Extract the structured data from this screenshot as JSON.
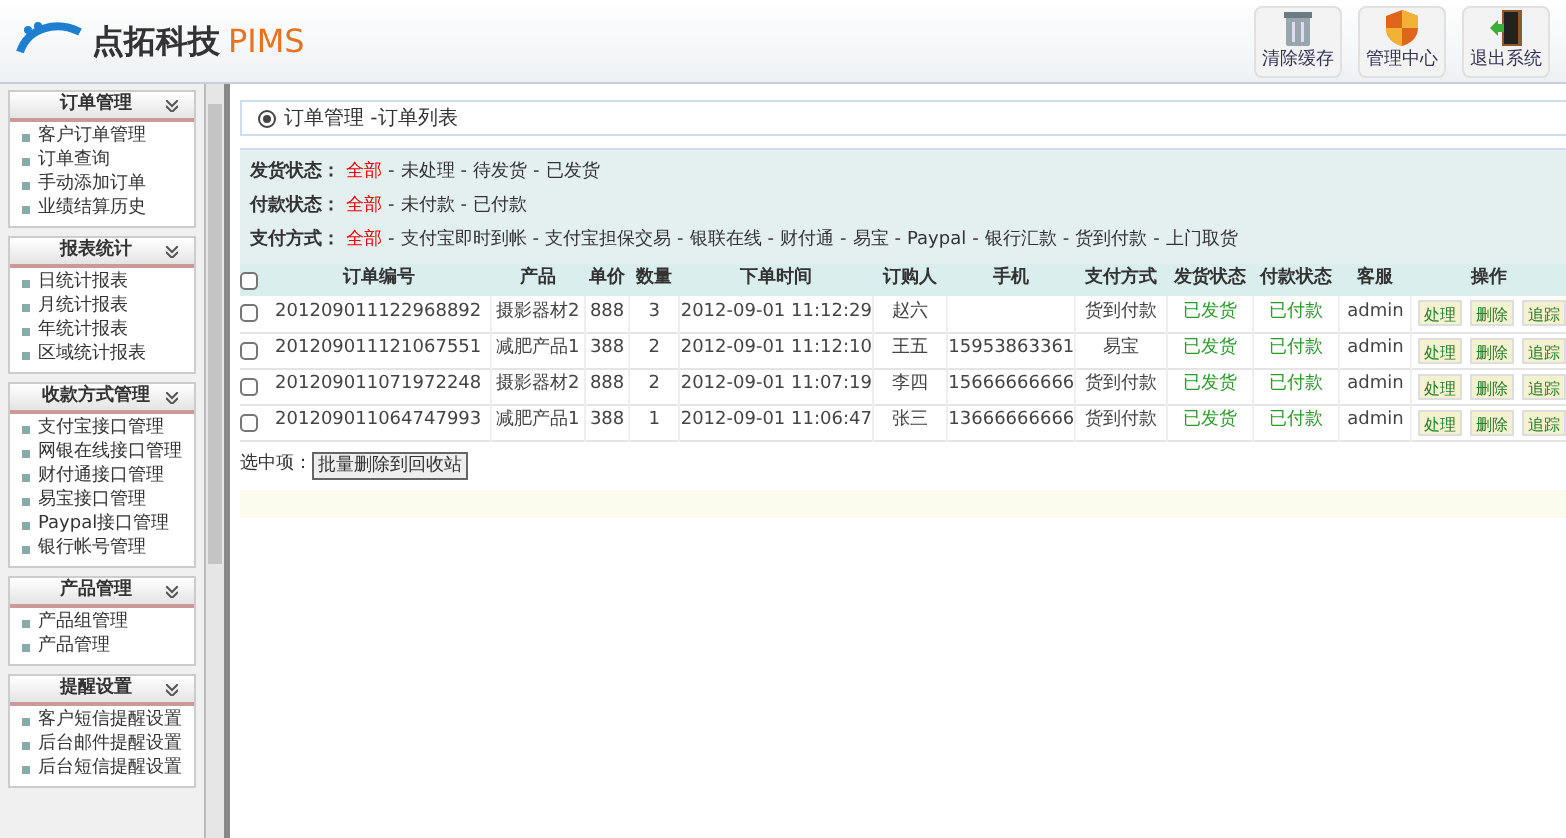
{
  "logo": {
    "name": "点拓科技",
    "product": "PIMS"
  },
  "header_buttons": [
    {
      "label": "清除缓存",
      "kind": "trash"
    },
    {
      "label": "管理中心",
      "kind": "shield"
    },
    {
      "label": "退出系统",
      "kind": "door"
    }
  ],
  "sidebar": {
    "groups": [
      {
        "title": "订单管理",
        "items": [
          "客户订单管理",
          "订单查询",
          "手动添加订单",
          "业绩结算历史"
        ]
      },
      {
        "title": "报表统计",
        "items": [
          "日统计报表",
          "月统计报表",
          "年统计报表",
          "区域统计报表"
        ]
      },
      {
        "title": "收款方式管理",
        "items": [
          "支付宝接口管理",
          "网银在线接口管理",
          "财付通接口管理",
          "易宝接口管理",
          "Paypal接口管理",
          "银行帐号管理"
        ]
      },
      {
        "title": "产品管理",
        "items": [
          "产品组管理",
          "产品管理"
        ]
      },
      {
        "title": "提醒设置",
        "items": [
          "客户短信提醒设置",
          "后台邮件提醒设置",
          "后台短信提醒设置"
        ]
      }
    ]
  },
  "page_title": "订单管理 -订单列表",
  "filters": [
    {
      "label": "发货状态：",
      "separator": "-",
      "options": [
        {
          "text": "全部",
          "selected": true
        },
        {
          "text": "未处理",
          "selected": false
        },
        {
          "text": "待发货",
          "selected": false
        },
        {
          "text": "已发货",
          "selected": false
        }
      ]
    },
    {
      "label": "付款状态：",
      "separator": "-",
      "options": [
        {
          "text": "全部",
          "selected": true
        },
        {
          "text": "未付款",
          "selected": false
        },
        {
          "text": "已付款",
          "selected": false
        }
      ]
    },
    {
      "label": "支付方式：",
      "separator": "-",
      "options": [
        {
          "text": "全部",
          "selected": true
        },
        {
          "text": "支付宝即时到帐",
          "selected": false
        },
        {
          "text": "支付宝担保交易",
          "selected": false
        },
        {
          "text": "银联在线",
          "selected": false
        },
        {
          "text": "财付通",
          "selected": false
        },
        {
          "text": "易宝",
          "selected": false
        },
        {
          "text": "Paypal",
          "selected": false
        },
        {
          "text": "银行汇款",
          "selected": false
        },
        {
          "text": "货到付款",
          "selected": false
        },
        {
          "text": "上门取货",
          "selected": false
        }
      ]
    }
  ],
  "table": {
    "columns": [
      "订单编号",
      "产品",
      "单价",
      "数量",
      "下单时间",
      "订购人",
      "手机",
      "支付方式",
      "发货状态",
      "付款状态",
      "客服",
      "操作"
    ],
    "rows": [
      {
        "checked": false,
        "cells": [
          "201209011122968892",
          "摄影器材2",
          "888",
          "3",
          "2012-09-01 11:12:29",
          "赵六",
          "",
          "货到付款",
          "已发货",
          "已付款",
          "admin"
        ],
        "actions": [
          "处理",
          "删除",
          "追踪"
        ]
      },
      {
        "checked": false,
        "cells": [
          "201209011121067551",
          "减肥产品1",
          "388",
          "2",
          "2012-09-01 11:12:10",
          "王五",
          "15953863361",
          "易宝",
          "已发货",
          "已付款",
          "admin"
        ],
        "actions": [
          "处理",
          "删除",
          "追踪"
        ]
      },
      {
        "checked": false,
        "cells": [
          "201209011071972248",
          "摄影器材2",
          "888",
          "2",
          "2012-09-01 11:07:19",
          "李四",
          "15666666666",
          "货到付款",
          "已发货",
          "已付款",
          "admin"
        ],
        "actions": [
          "处理",
          "删除",
          "追踪"
        ]
      },
      {
        "checked": false,
        "cells": [
          "201209011064747993",
          "减肥产品1",
          "388",
          "1",
          "2012-09-01 11:06:47",
          "张三",
          "13666666666",
          "货到付款",
          "已发货",
          "已付款",
          "admin"
        ],
        "actions": [
          "处理",
          "删除",
          "追踪"
        ]
      }
    ]
  },
  "select_all": {
    "checked": false
  },
  "bulk": {
    "label": "选中项：",
    "button": "批量删除到回收站"
  }
}
